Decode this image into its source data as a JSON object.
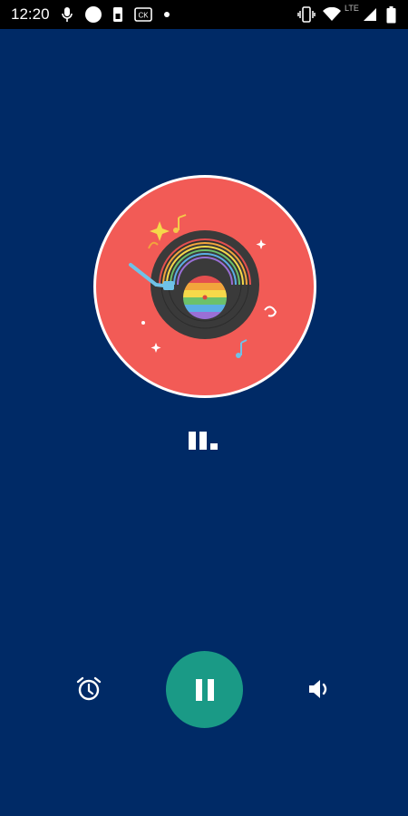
{
  "status_bar": {
    "time": "12:20",
    "network_label": "LTE",
    "icons": [
      "mic-icon",
      "circle-icon",
      "sim-icon",
      "media-icon",
      "dot-icon",
      "vibrate-icon",
      "wifi-icon",
      "signal-icon",
      "battery-icon"
    ]
  },
  "player": {
    "artwork_icon": "vinyl-record-illustration",
    "visualizer_icon": "equalizer-icon",
    "state": "playing"
  },
  "controls": {
    "alarm_icon": "alarm-icon",
    "play_pause_icon": "pause-icon",
    "volume_icon": "volume-icon"
  },
  "colors": {
    "background": "#002a66",
    "artwork_circle": "#f25b56",
    "play_button": "#1a9a86",
    "status_bar": "#000000"
  }
}
